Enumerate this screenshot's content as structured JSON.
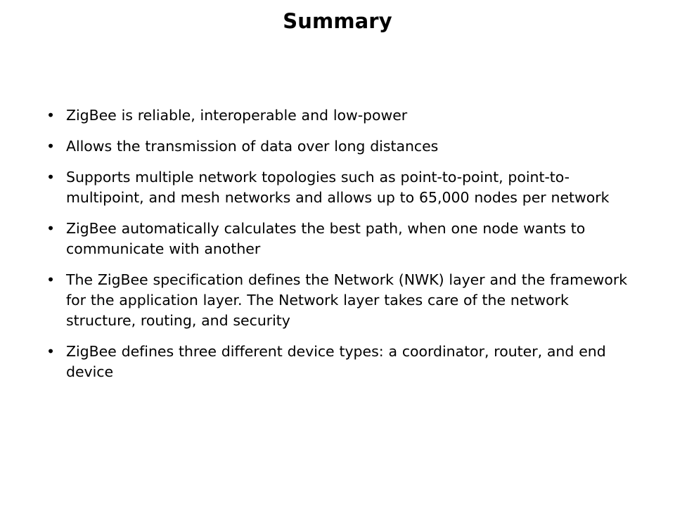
{
  "slide": {
    "title": "Summary",
    "background_color": "#ffffff",
    "text_color": "#000000",
    "bullet_glyph": "•",
    "bullets": [
      {
        "text": "ZigBee is reliable, interoperable and low-power"
      },
      {
        "text": "Allows the transmission of data over long distances"
      },
      {
        "text": "Supports multiple network topologies such as point-to-point, point-to-multipoint, and mesh networks and allows up to 65,000 nodes per network"
      },
      {
        "text": "ZigBee automatically calculates the best path, when one node wants to communicate with another"
      },
      {
        "text": "The ZigBee specification defines the Network (NWK) layer and the framework for the application layer. The Network layer takes care of the network structure, routing, and security"
      },
      {
        "text": "ZigBee defines three different device types: a coordinator, router, and end device"
      }
    ]
  }
}
